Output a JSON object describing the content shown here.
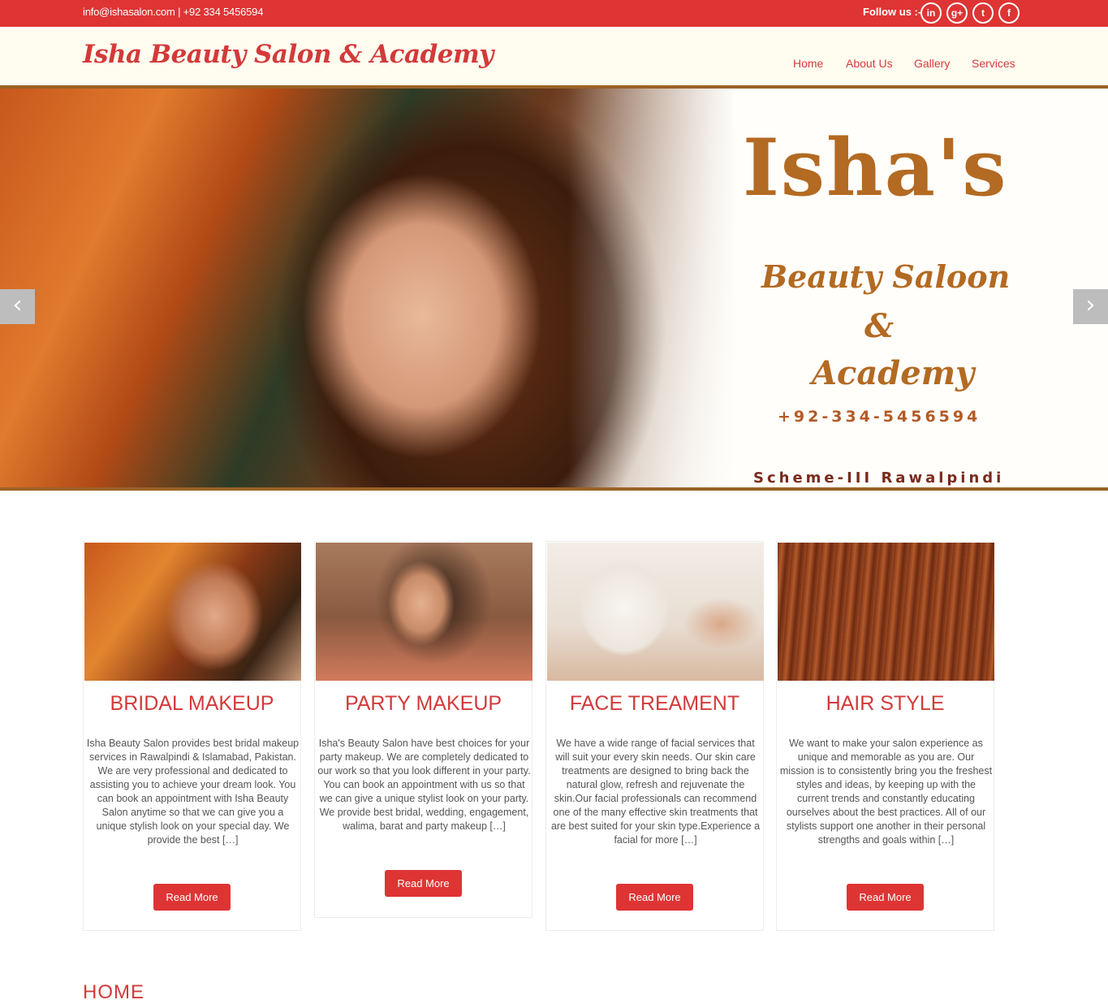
{
  "topbar": {
    "contact": "info@ishasalon.com  |  +92 334 5456594",
    "follow_label": "Follow us :-",
    "social": [
      "in",
      "g+",
      "t",
      "f"
    ]
  },
  "header": {
    "logo": "Isha Beauty Salon & Academy",
    "nav": [
      "Home",
      "About Us",
      "Gallery",
      "Services"
    ]
  },
  "slider": {
    "title": "Isha's",
    "line1": "Beauty Saloon",
    "line2": "&",
    "line3": "Academy",
    "phone": "+92-334-5456594",
    "address": "Scheme-III Rawalpindi",
    "prev_icon": "‹",
    "next_icon": "›"
  },
  "services": [
    {
      "title": "BRIDAL MAKEUP",
      "description": "Isha Beauty Salon provides best bridal makeup services in Rawalpindi & Islamabad, Pakistan. We are very professional and dedicated to assisting you to achieve your dream look. You can book an appointment with Isha Beauty Salon anytime so that we can give you a unique stylish look on your special day. We provide the best […]",
      "button": "Read More"
    },
    {
      "title": "PARTY MAKEUP",
      "description": "Isha's Beauty Salon have best choices for your party makeup. We are completely dedicated to our work so that you look different in your party. You can book an appointment with us so that we can give a unique stylist look on your party. We provide best bridal, wedding, engagement, walima, barat and party makeup […]",
      "button": "Read More"
    },
    {
      "title": "FACE TREAMENT",
      "description": "We have a wide range of facial services that will suit your every skin needs. Our skin care treatments are designed to bring back the natural glow, refresh and rejuvenate the skin.Our facial professionals can recommend one of the many effective skin treatments that are best suited for your skin type.Experience a facial for more […]",
      "button": "Read More"
    },
    {
      "title": "HAIR STYLE",
      "description": "We want to make your salon experience as unique and memorable as you are. Our mission is to consistently bring you the freshest styles and ideas, by keeping up with the current trends and constantly educating ourselves about the best practices. All of our stylists support one another in their personal strengths and goals within […]",
      "button": "Read More"
    }
  ],
  "section": {
    "title": "HOME"
  },
  "colors": {
    "accent": "#de3434",
    "gold": "#b36a22"
  }
}
